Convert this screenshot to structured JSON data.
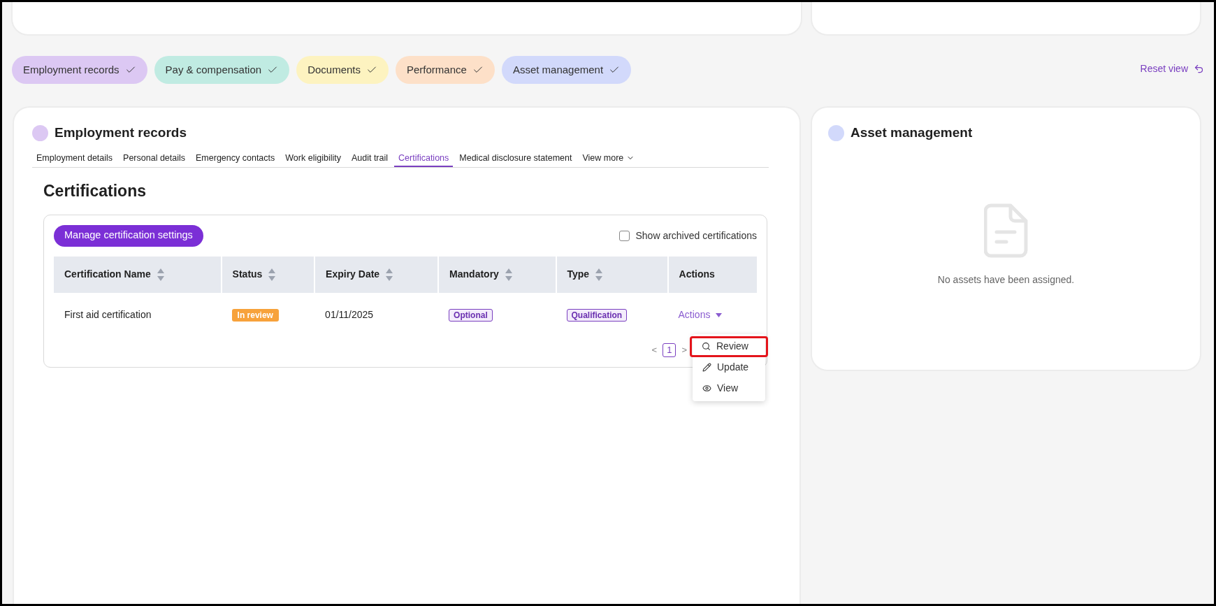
{
  "filters": [
    {
      "label": "Employment records",
      "color": "#dcc8f3",
      "checked": true
    },
    {
      "label": "Pay & compensation",
      "color": "#c0ebe2",
      "checked": true
    },
    {
      "label": "Documents",
      "color": "#fdf3c0",
      "checked": true
    },
    {
      "label": "Performance",
      "color": "#fde0c8",
      "checked": true
    },
    {
      "label": "Asset management",
      "color": "#d2d9fb",
      "checked": true
    }
  ],
  "reset_view": "Reset view",
  "employment_panel": {
    "title": "Employment records",
    "color": "#dcc8f3",
    "tabs": [
      {
        "label": "Employment details",
        "selected": false
      },
      {
        "label": "Personal details",
        "selected": false
      },
      {
        "label": "Emergency contacts",
        "selected": false
      },
      {
        "label": "Work eligibility",
        "selected": false
      },
      {
        "label": "Audit trail",
        "selected": false
      },
      {
        "label": "Certifications",
        "selected": true
      },
      {
        "label": "Medical disclosure statement",
        "selected": false
      }
    ],
    "view_more": "View more",
    "heading": "Certifications",
    "manage_button": "Manage certification settings",
    "show_archived": {
      "label": "Show archived certifications",
      "checked": false
    },
    "table": {
      "columns": [
        {
          "label": "Certification Name",
          "sortable": true
        },
        {
          "label": "Status",
          "sortable": true
        },
        {
          "label": "Expiry Date",
          "sortable": true
        },
        {
          "label": "Mandatory",
          "sortable": true
        },
        {
          "label": "Type",
          "sortable": true
        },
        {
          "label": "Actions",
          "sortable": false
        }
      ],
      "rows": [
        {
          "name": "First aid certification",
          "status": "In review",
          "expiry": "01/11/2025",
          "mandatory": "Optional",
          "type": "Qualification",
          "actions": "Actions"
        }
      ]
    },
    "pagination": {
      "prev": "<",
      "page": "1",
      "next": ">"
    },
    "actions_menu": [
      {
        "kind": "search",
        "label": "Review",
        "highlighted": true
      },
      {
        "kind": "pencil",
        "label": "Update",
        "highlighted": false
      },
      {
        "kind": "eye",
        "label": "View",
        "highlighted": false
      }
    ]
  },
  "asset_panel": {
    "title": "Asset management",
    "color": "#d2d9fb",
    "empty_message": "No assets have been assigned."
  }
}
